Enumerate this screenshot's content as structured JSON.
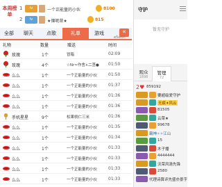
{
  "rank": {
    "week_label": "本周榜单",
    "rows": [
      {
        "num": "1",
        "badge": "lv",
        "name": "一个正能量的小伙",
        "value": "8100"
      },
      {
        "num": "2",
        "badge": "lv",
        "name": "★傈呢荩★",
        "value": "815"
      }
    ]
  },
  "tabs": [
    "全部",
    "聊天",
    "点歌",
    "礼单",
    "游戏"
  ],
  "active_tab": "礼单",
  "collapse_label": "«",
  "user_id": "e5w6h",
  "columns": {
    "gift": "礼物",
    "qty": "数量",
    "from": "赠送",
    "time": "时间"
  },
  "gifts": [
    {
      "icon": "rose",
      "name": "玫瑰",
      "qty": "1个",
      "from": "冒箱",
      "time": "02:09"
    },
    {
      "icon": "rose",
      "name": "玫瑰",
      "qty": "4个",
      "from": "☆Nr≈作舍∧二茎●",
      "time": "01:50"
    },
    {
      "icon": "lips",
      "name": "么么",
      "qty": "1个",
      "from": "一个正能量的小伙",
      "time": "01:50"
    },
    {
      "icon": "lips",
      "name": "么么",
      "qty": "1个",
      "from": "一个正能量的小伙",
      "time": "01:37"
    },
    {
      "icon": "lips",
      "name": "么么",
      "qty": "1个",
      "from": "一个正能量的小伙",
      "time": "01:36"
    },
    {
      "icon": "lips",
      "name": "么么",
      "qty": "1个",
      "from": "一个正能量的小伙",
      "time": "01:36"
    },
    {
      "icon": "mic",
      "name": "手机星星",
      "qty": "9个",
      "from": "松果桃仁三米",
      "time": "01:36"
    },
    {
      "icon": "lips",
      "name": "么么",
      "qty": "1个",
      "from": "一个正能量的小伙",
      "time": "01:35"
    },
    {
      "icon": "lips",
      "name": "么么",
      "qty": "1个",
      "from": "一个正能量的小伙",
      "time": "01:34"
    },
    {
      "icon": "lips",
      "name": "么么",
      "qty": "1个",
      "from": "一个正能量的小伙",
      "time": "01:33"
    },
    {
      "icon": "lips",
      "name": "么么",
      "qty": "1个",
      "from": "一个正能量的小伙",
      "time": "01:33"
    },
    {
      "icon": "lips",
      "name": "么么",
      "qty": "1个",
      "from": "一个正能量的小伙",
      "time": "01:33"
    },
    {
      "icon": "lips",
      "name": "么么",
      "qty": "1个",
      "from": "一个正能量的小伙",
      "time": "01:33"
    }
  ],
  "guard": {
    "title": "守护",
    "empty_text": "暂无守护"
  },
  "right_tabs": [
    {
      "label": "观众",
      "count": "1898"
    },
    {
      "label": "管理",
      "count": "72"
    },
    {
      "label": "",
      "count": ""
    }
  ],
  "users": [
    {
      "badge": "2♥",
      "name": "859192",
      "sub": "",
      "name2": ""
    },
    {
      "badge": "",
      "name": "要超级爱守护",
      "sub": "",
      "name2": ""
    },
    {
      "badge": "",
      "name": "无痕✦风云",
      "sub": "",
      "name2": ""
    },
    {
      "badge": "",
      "name": "81505",
      "sub": "",
      "name2": ""
    },
    {
      "badge": "",
      "name": "云菜★",
      "sub": "",
      "name2": ""
    },
    {
      "badge": "",
      "name": "99678",
      "sub": "",
      "name2": ""
    },
    {
      "badge": "",
      "name": "霸神✧✧江山",
      "sub": "",
      "name2": ""
    },
    {
      "badge": "",
      "name": "15",
      "sub": "",
      "name2": ""
    },
    {
      "badge": "",
      "name": "木子播",
      "sub": "",
      "name2": ""
    },
    {
      "badge": "",
      "name": "4444444",
      "sub": "",
      "name2": ""
    },
    {
      "badge": "",
      "name": "沃荣风清先锋",
      "sub": "",
      "name2": ""
    },
    {
      "badge": "",
      "name": "2580",
      "sub": "",
      "name2": ""
    },
    {
      "badge": "",
      "name": "代理诗算评先盛亦景字",
      "sub": "",
      "name2": ""
    }
  ],
  "colors": {
    "accent": "#ee6b4a",
    "coin": "#f0b020",
    "rose": "#d42020"
  }
}
